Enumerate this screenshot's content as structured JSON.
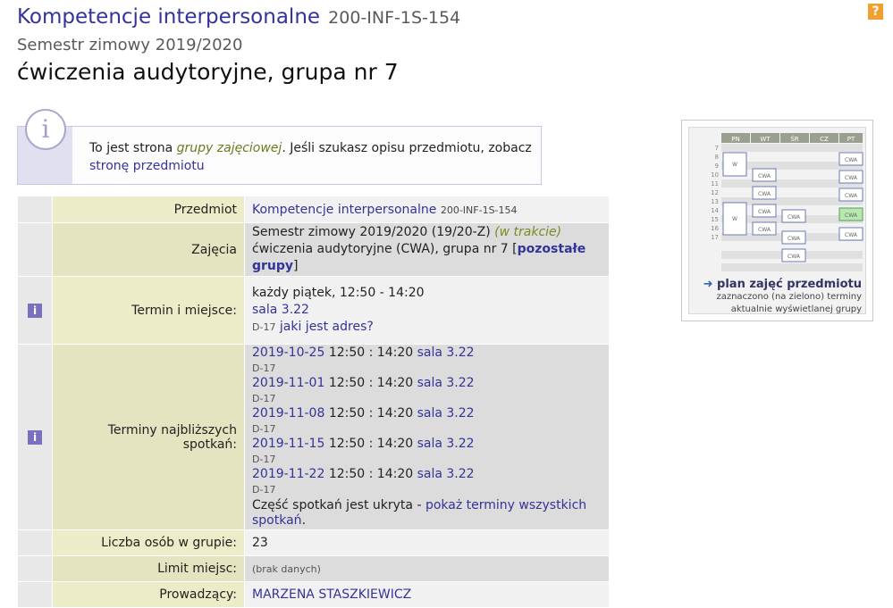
{
  "header": {
    "course_name": "Kompetencje interpersonalne",
    "course_code": "200-INF-1S-154",
    "semester": "Semestr zimowy 2019/2020",
    "group_heading": "ćwiczenia audytoryjne, grupa nr 7",
    "help_icon": "?"
  },
  "notice": {
    "text_before": "To jest strona ",
    "group_link": "grupy zajęciowej",
    "text_after": ". Jeśli szukasz opisu przedmiotu, zobacz",
    "subject_link": "stronę przedmiotu"
  },
  "details": {
    "subject": {
      "label": "Przedmiot",
      "name": "Kompetencje interpersonalne",
      "code": "200-INF-1S-154"
    },
    "classes": {
      "label": "Zajęcia",
      "line1": "Semestr zimowy 2019/2020 (19/20-Z)",
      "in_progress": "(w trakcie)",
      "line2": "ćwiczenia audytoryjne (CWA), grupa nr 7",
      "other_groups": "pozostałe grupy",
      "bracket_open": "[",
      "bracket_close": "]"
    },
    "term": {
      "label": "Termin i miejsce:",
      "when": "każdy piątek, 12:50 - 14:20",
      "room": "sala 3.22",
      "building": "D-17",
      "address_link": "jaki jest adres?"
    },
    "meetings": {
      "label": "Terminy najbliższych spotkań:",
      "items": [
        {
          "date": "2019-10-25",
          "time": "12:50 : 14:20",
          "room": "sala 3.22",
          "building": "D-17"
        },
        {
          "date": "2019-11-01",
          "time": "12:50 : 14:20",
          "room": "sala 3.22",
          "building": "D-17"
        },
        {
          "date": "2019-11-08",
          "time": "12:50 : 14:20",
          "room": "sala 3.22",
          "building": "D-17"
        },
        {
          "date": "2019-11-15",
          "time": "12:50 : 14:20",
          "room": "sala 3.22",
          "building": "D-17"
        },
        {
          "date": "2019-11-22",
          "time": "12:50 : 14:20",
          "room": "sala 3.22",
          "building": "D-17"
        }
      ],
      "hidden_text": "Część spotkań jest ukryta - ",
      "show_all_link": "pokaż terminy wszystkich spotkań",
      "hidden_end": "."
    },
    "group_size": {
      "label": "Liczba osób w grupie:",
      "value": "23"
    },
    "limit": {
      "label": "Limit miejsc:",
      "value": "(brak danych)"
    },
    "teachers": {
      "label": "Prowadzący:",
      "value": "MARZENA STASZKIEWICZ"
    }
  },
  "schedule_thumb": {
    "days": [
      "PN",
      "WT",
      "ŚR",
      "CZ",
      "PT"
    ],
    "hours": [
      "7",
      "8",
      "9",
      "10",
      "11",
      "12",
      "13",
      "14",
      "15",
      "16",
      "17"
    ],
    "link": "plan zajęć przedmiotu",
    "note1": "zaznaczono (na zielono) terminy",
    "note2": "aktualnie wyświetlanej grupy",
    "block_w": "W",
    "block_cwa": "CWA",
    "arrow": "➜",
    "colors": {
      "highlight": "#b8e8b0",
      "block": "#ffffff",
      "block_border": "#6a7ab0"
    }
  },
  "icons": {
    "info_square": "i",
    "info_circle": "i"
  }
}
